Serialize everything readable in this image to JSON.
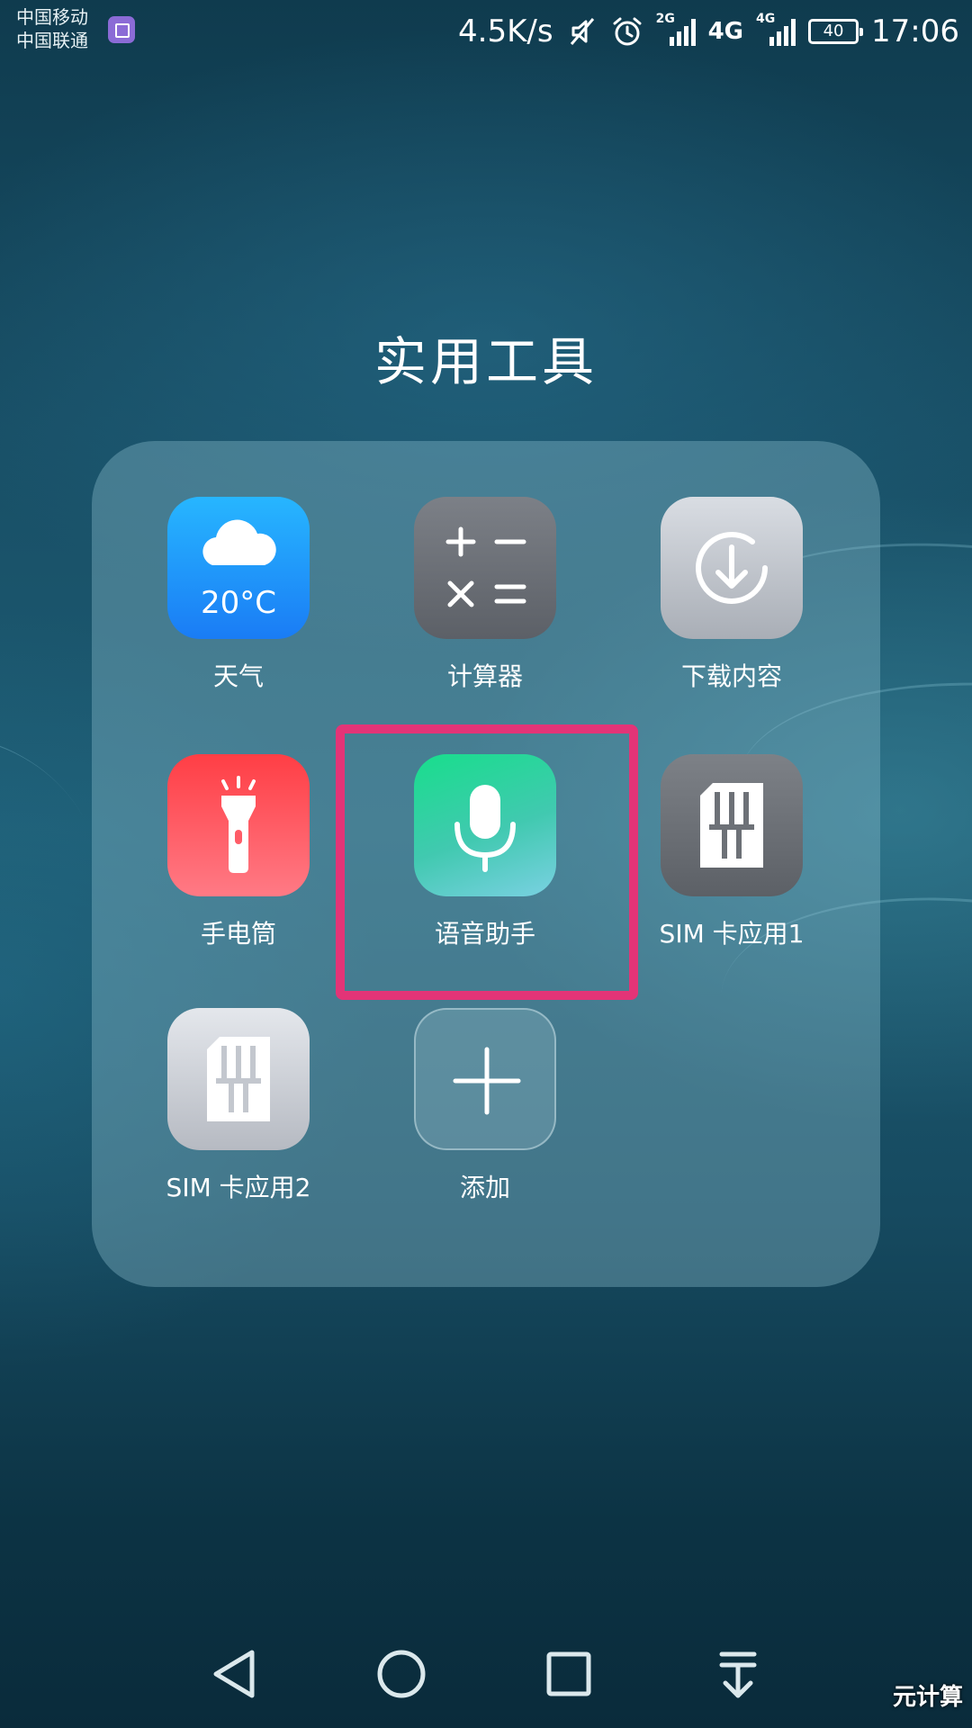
{
  "status_bar": {
    "carrier_1": "中国移动",
    "carrier_2": "中国联通",
    "network_speed": "4.5K/s",
    "signal_1_tag": "2G",
    "signal_2_tag": "4G",
    "network_type": "4G",
    "battery": "40",
    "time": "17:06"
  },
  "folder": {
    "title": "实用工具",
    "apps": [
      {
        "label": "天气",
        "icon": "weather-icon",
        "temp": "20°C"
      },
      {
        "label": "计算器",
        "icon": "calculator-icon"
      },
      {
        "label": "下载内容",
        "icon": "download-icon"
      },
      {
        "label": "手电筒",
        "icon": "flashlight-icon"
      },
      {
        "label": "语音助手",
        "icon": "microphone-icon"
      },
      {
        "label": "SIM 卡应用1",
        "icon": "sim-card-icon"
      },
      {
        "label": "SIM 卡应用2",
        "icon": "sim-card-icon"
      },
      {
        "label": "添加",
        "icon": "plus-icon"
      }
    ]
  },
  "highlight_color": "#e33477",
  "nav_bar": {
    "back": "back-icon",
    "home": "home-icon",
    "recents": "recents-icon",
    "notifications": "pull-down-icon"
  },
  "watermark": "元计算"
}
